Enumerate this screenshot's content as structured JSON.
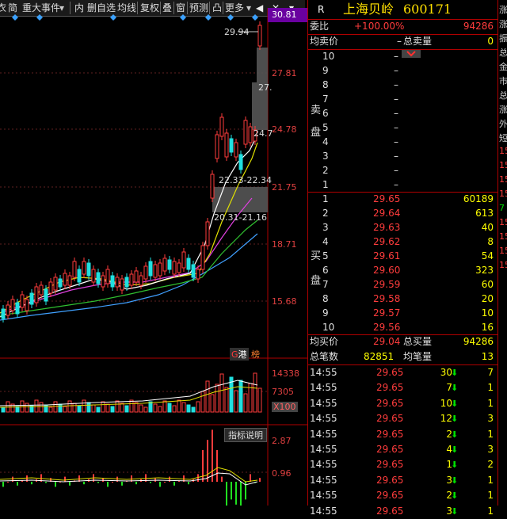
{
  "toolbar": {
    "items": [
      "衣",
      "简",
      "重大事件",
      "内",
      "删自选",
      "均线",
      "复权",
      "叠",
      "窗",
      "预测",
      "凸",
      "更多"
    ]
  },
  "chart": {
    "price_labels": [
      "30.81",
      "27.81",
      "24.78",
      "21.75",
      "18.71",
      "15.68"
    ],
    "annotations": {
      "high": "29.94",
      "mid": "27.",
      "mid2": "24.7",
      "range1": "22.33-22.34",
      "range2": "20.31-21.16"
    },
    "badges": {
      "hk": "港",
      "bang": "榜"
    },
    "volume_labels": [
      "14338",
      "7305",
      "X100"
    ],
    "indicator_button": "指标说明",
    "indicator_labels": [
      "2.87",
      "0.96"
    ]
  },
  "quote": {
    "r_label": "R",
    "name": "上海贝岭",
    "code": "600171",
    "weibi_label": "委比",
    "weibi_value": "+100.00%",
    "weibi_diff": "94286",
    "avg_sell_label": "均卖价",
    "avg_sell_value": "–",
    "total_sell_label": "总卖量",
    "total_sell_value": "0",
    "sell_side_label_1": "卖",
    "sell_side_label_2": "盘",
    "sell_levels": [
      {
        "n": "10",
        "p": "–",
        "q": ""
      },
      {
        "n": "9",
        "p": "–",
        "q": ""
      },
      {
        "n": "8",
        "p": "–",
        "q": ""
      },
      {
        "n": "7",
        "p": "–",
        "q": ""
      },
      {
        "n": "6",
        "p": "–",
        "q": ""
      },
      {
        "n": "5",
        "p": "–",
        "q": ""
      },
      {
        "n": "4",
        "p": "–",
        "q": ""
      },
      {
        "n": "3",
        "p": "–",
        "q": ""
      },
      {
        "n": "2",
        "p": "–",
        "q": ""
      },
      {
        "n": "1",
        "p": "–",
        "q": ""
      }
    ],
    "buy_side_label_1": "买",
    "buy_side_label_2": "盘",
    "buy_levels": [
      {
        "n": "1",
        "p": "29.65",
        "q": "60189"
      },
      {
        "n": "2",
        "p": "29.64",
        "q": "613"
      },
      {
        "n": "3",
        "p": "29.63",
        "q": "40"
      },
      {
        "n": "4",
        "p": "29.62",
        "q": "8"
      },
      {
        "n": "5",
        "p": "29.61",
        "q": "54"
      },
      {
        "n": "6",
        "p": "29.60",
        "q": "323"
      },
      {
        "n": "7",
        "p": "29.59",
        "q": "60"
      },
      {
        "n": "8",
        "p": "29.58",
        "q": "20"
      },
      {
        "n": "9",
        "p": "29.57",
        "q": "10"
      },
      {
        "n": "10",
        "p": "29.56",
        "q": "16"
      }
    ],
    "avg_buy_label": "均买价",
    "avg_buy_value": "29.04",
    "total_buy_label": "总买量",
    "total_buy_value": "94286",
    "total_trades_label": "总笔数",
    "total_trades_value": "82851",
    "avg_trade_label": "均笔量",
    "avg_trade_value": "13",
    "ticks": [
      {
        "t": "14:55",
        "p": "29.65",
        "v": "30",
        "d": "down",
        "n": "7"
      },
      {
        "t": "14:55",
        "p": "29.65",
        "v": "7",
        "d": "down",
        "n": "1"
      },
      {
        "t": "14:55",
        "p": "29.65",
        "v": "10",
        "d": "down",
        "n": "1"
      },
      {
        "t": "14:55",
        "p": "29.65",
        "v": "12",
        "d": "down",
        "n": "3"
      },
      {
        "t": "14:55",
        "p": "29.65",
        "v": "2",
        "d": "down",
        "n": "1"
      },
      {
        "t": "14:55",
        "p": "29.65",
        "v": "4",
        "d": "down",
        "n": "3"
      },
      {
        "t": "14:55",
        "p": "29.65",
        "v": "1",
        "d": "down",
        "n": "2"
      },
      {
        "t": "14:55",
        "p": "29.65",
        "v": "3",
        "d": "down",
        "n": "1"
      },
      {
        "t": "14:55",
        "p": "29.65",
        "v": "2",
        "d": "down",
        "n": "1"
      },
      {
        "t": "14:55",
        "p": "29.65",
        "v": "3",
        "d": "down",
        "n": "1"
      }
    ]
  },
  "edge_column": [
    "涨",
    "涨",
    "振",
    "总",
    "金",
    "市",
    "总",
    "涨",
    "外",
    "短",
    "15",
    "15",
    "15",
    "15",
    "7",
    "15",
    "15",
    "15",
    "15"
  ]
}
